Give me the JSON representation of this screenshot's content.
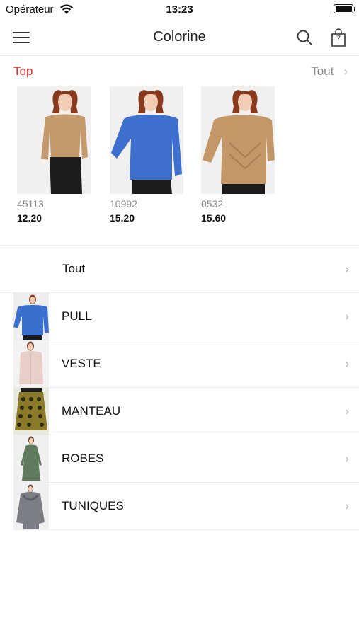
{
  "status_bar": {
    "carrier": "Opérateur",
    "time": "13:23"
  },
  "nav": {
    "title": "Colorine",
    "cart_count": "7"
  },
  "top_section": {
    "label": "Top",
    "all_label": "Tout",
    "products": [
      {
        "code": "45113",
        "price": "12.20",
        "color": "#c49a6c"
      },
      {
        "code": "10992",
        "price": "15.20",
        "color": "#3e6fcf"
      },
      {
        "code": "0532",
        "price": "15.60",
        "color": "#c39767"
      }
    ]
  },
  "categories": [
    {
      "label": "Tout"
    },
    {
      "label": "PULL",
      "color": "#3a6fcf"
    },
    {
      "label": "VESTE",
      "color": "#e7cfc8"
    },
    {
      "label": "MANTEAU",
      "color": "#8a7a2a"
    },
    {
      "label": "ROBES",
      "color": "#5f7a5c"
    },
    {
      "label": "TUNIQUES",
      "color": "#7d7d84"
    }
  ],
  "colors": {
    "accent": "#e0302b",
    "muted": "#8a8a8a"
  }
}
